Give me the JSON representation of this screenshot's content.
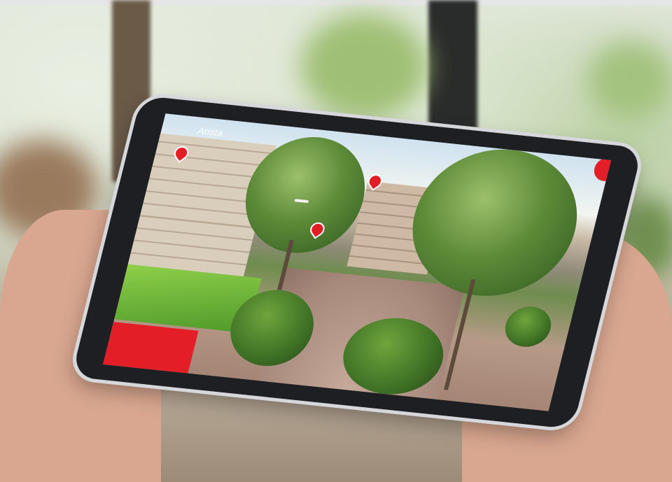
{
  "scene": {
    "description_tag": "tablet-vr-tour",
    "accent_color": "#e41e26"
  },
  "tablet_screen": {
    "logo_text": "Arista",
    "hotspot_label": "",
    "cta_label": "",
    "footer_text": ""
  }
}
